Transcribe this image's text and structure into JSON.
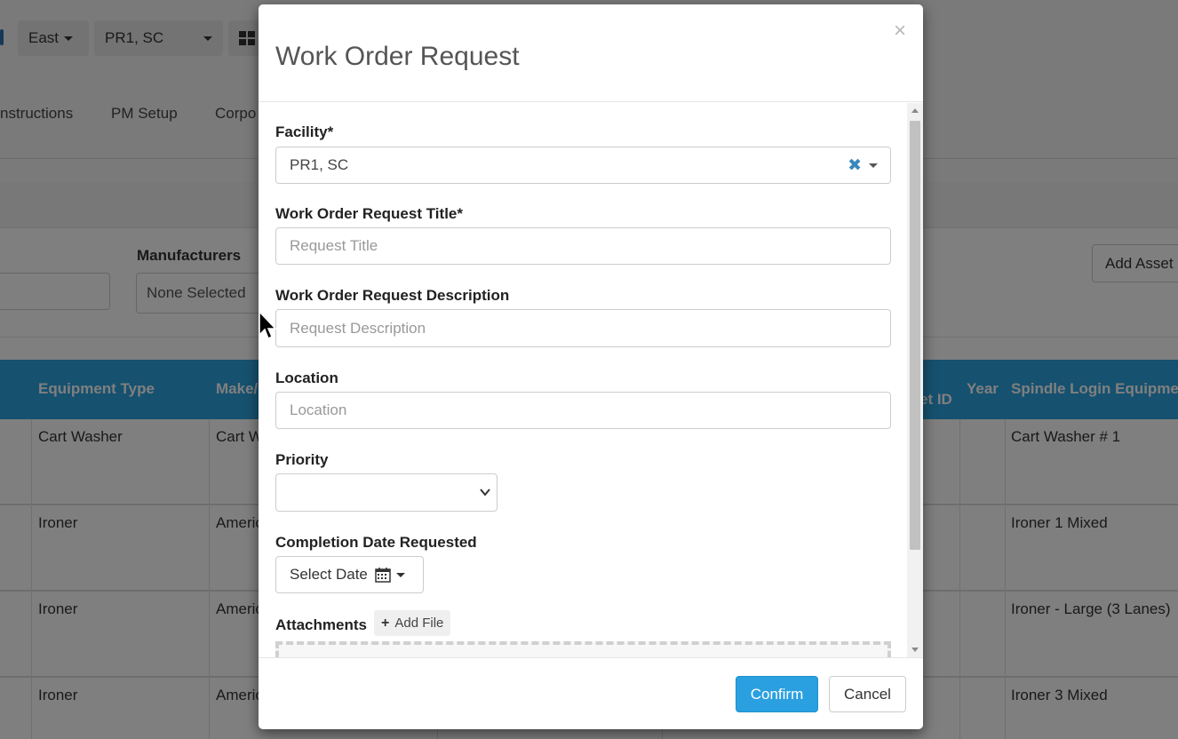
{
  "background": {
    "region_button": "East",
    "facility_button": "PR1, SC",
    "nav": [
      "nstructions",
      "PM Setup",
      "Corpo"
    ],
    "manufacturers_label": "Manufacturers",
    "manufacturers_value": "None Selected",
    "add_asset_button": "Add Asset",
    "columns": [
      "Equipment Type",
      "Make/",
      "et ID",
      "Year",
      "Spindle Login Equipme"
    ],
    "rows": [
      {
        "type": "Cart Washer",
        "make": "Cart W",
        "spindle": "Cart Washer # 1"
      },
      {
        "type": "Ironer",
        "make": "Americ",
        "spindle": "Ironer 1 Mixed"
      },
      {
        "type": "Ironer",
        "make": "Americ",
        "spindle": "Ironer - Large (3 Lanes)"
      },
      {
        "type": "Ironer",
        "make": "Americ",
        "spindle": "Ironer 3 Mixed"
      }
    ]
  },
  "modal": {
    "title": "Work Order Request",
    "close_symbol": "×",
    "facility": {
      "label": "Facility*",
      "value": "PR1, SC",
      "clear_symbol": "✖"
    },
    "title_field": {
      "label": "Work Order Request Title*",
      "placeholder": "Request Title"
    },
    "description_field": {
      "label": "Work Order Request Description",
      "placeholder": "Request Description"
    },
    "location_field": {
      "label": "Location",
      "placeholder": "Location"
    },
    "priority": {
      "label": "Priority",
      "value": ""
    },
    "completion_date": {
      "label": "Completion Date Requested",
      "button_label": "Select Date"
    },
    "attachments": {
      "label": "Attachments",
      "add_file_label": "Add File",
      "add_file_symbol": "+"
    },
    "confirm_label": "Confirm",
    "cancel_label": "Cancel"
  },
  "colors": {
    "accent": "#2aa0e0",
    "table_header": "#2da3df",
    "clear_icon": "#3a86bd"
  },
  "icons": [
    "close-icon",
    "clear-icon",
    "chevron-down-icon",
    "calendar-icon",
    "plus-icon",
    "cursor-icon",
    "grid-icon"
  ]
}
